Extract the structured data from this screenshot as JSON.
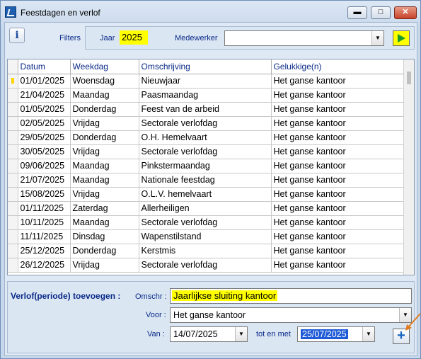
{
  "window": {
    "title": "Feestdagen en verlof",
    "min": "▬",
    "max": "□",
    "close": "✕"
  },
  "filters": {
    "label": "Filters",
    "jaar_label": "Jaar",
    "jaar_value": "2025",
    "medewerker_label": "Medewerker",
    "medewerker_value": ""
  },
  "grid": {
    "columns": [
      "Datum",
      "Weekdag",
      "Omschrijving",
      "Gelukkige(n)"
    ],
    "rows": [
      [
        "01/01/2025",
        "Woensdag",
        "Nieuwjaar",
        "Het ganse kantoor"
      ],
      [
        "21/04/2025",
        "Maandag",
        "Paasmaandag",
        "Het ganse kantoor"
      ],
      [
        "01/05/2025",
        "Donderdag",
        "Feest van de arbeid",
        "Het ganse kantoor"
      ],
      [
        "02/05/2025",
        "Vrijdag",
        "Sectorale verlofdag",
        "Het ganse kantoor"
      ],
      [
        "29/05/2025",
        "Donderdag",
        "O.H. Hemelvaart",
        "Het ganse kantoor"
      ],
      [
        "30/05/2025",
        "Vrijdag",
        "Sectorale verlofdag",
        "Het ganse kantoor"
      ],
      [
        "09/06/2025",
        "Maandag",
        "Pinkstermaandag",
        "Het ganse kantoor"
      ],
      [
        "21/07/2025",
        "Maandag",
        "Nationale feestdag",
        "Het ganse kantoor"
      ],
      [
        "15/08/2025",
        "Vrijdag",
        "O.L.V. hemelvaart",
        "Het ganse kantoor"
      ],
      [
        "01/11/2025",
        "Zaterdag",
        "Allerheiligen",
        "Het ganse kantoor"
      ],
      [
        "10/11/2025",
        "Maandag",
        "Sectorale verlofdag",
        "Het ganse kantoor"
      ],
      [
        "11/11/2025",
        "Dinsdag",
        "Wapenstilstand",
        "Het ganse kantoor"
      ],
      [
        "25/12/2025",
        "Donderdag",
        "Kerstmis",
        "Het ganse kantoor"
      ],
      [
        "26/12/2025",
        "Vrijdag",
        "Sectorale verlofdag",
        "Het ganse kantoor"
      ]
    ]
  },
  "verlof": {
    "heading": "Verlof(periode) toevoegen :",
    "omschr_label": "Omschr :",
    "omschr_value": "Jaarlijkse sluiting kantoor",
    "voor_label": "Voor :",
    "voor_value": "Het ganse kantoor",
    "van_label": "Van :",
    "van_value": "14/07/2025",
    "tot_label": "tot en met",
    "tot_value": "25/07/2025",
    "add_label": "+"
  },
  "colors": {
    "highlight": "#ffff00",
    "label_blue": "#0a2a88",
    "go_green": "#1a9c2b"
  }
}
